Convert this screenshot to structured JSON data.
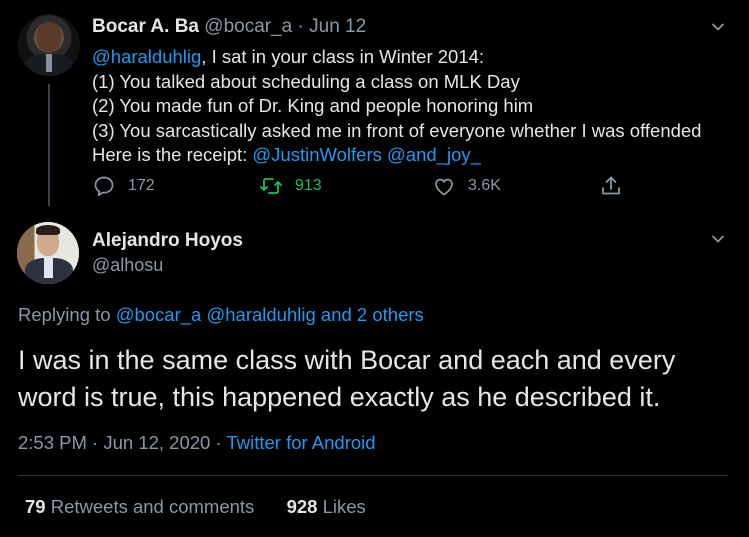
{
  "tweet1": {
    "author_name": "Bocar A. Ba",
    "author_handle": "@bocar_a",
    "separator": "·",
    "date": "Jun 12",
    "mention": "@haralduhlig",
    "line1_rest": ", I sat in your class in Winter 2014:",
    "line2": "(1) You talked about scheduling a class on MLK Day",
    "line3": "(2) You made fun of Dr. King and people honoring him",
    "line4": "(3) You sarcastically asked me in front of everyone whether I was offended",
    "line5_text": "Here is the receipt: ",
    "line5_mention1": "@JustinWolfers",
    "line5_mention2": "@and_joy_",
    "actions": {
      "replies": "172",
      "retweets": "913",
      "likes": "3.6K"
    },
    "icons": [
      "reply-icon",
      "retweet-icon",
      "like-icon",
      "share-icon",
      "chevron-down-icon"
    ]
  },
  "tweet2": {
    "author_name": "Alejandro Hoyos",
    "author_handle": "@alhosu",
    "replying_prefix": "Replying to ",
    "replying_to": "@bocar_a @haralduhlig and 2 others",
    "body_line1": "I was in the same class with Bocar and each and every",
    "body_line2": "word is true, this happened exactly as he described it.",
    "time": "2:53 PM",
    "meta_sep1": " · ",
    "date": "Jun 12, 2020",
    "meta_sep2": " · ",
    "source": "Twitter for Android",
    "stats": {
      "retweets_count": "79",
      "retweets_label": " Retweets and comments",
      "likes_count": "928",
      "likes_label": " Likes"
    }
  },
  "colors": {
    "background": "#000000",
    "link": "#1d9bf0",
    "muted": "#8b98a5",
    "retweet_green": "#17bf63",
    "text": "#e6e6e6"
  }
}
